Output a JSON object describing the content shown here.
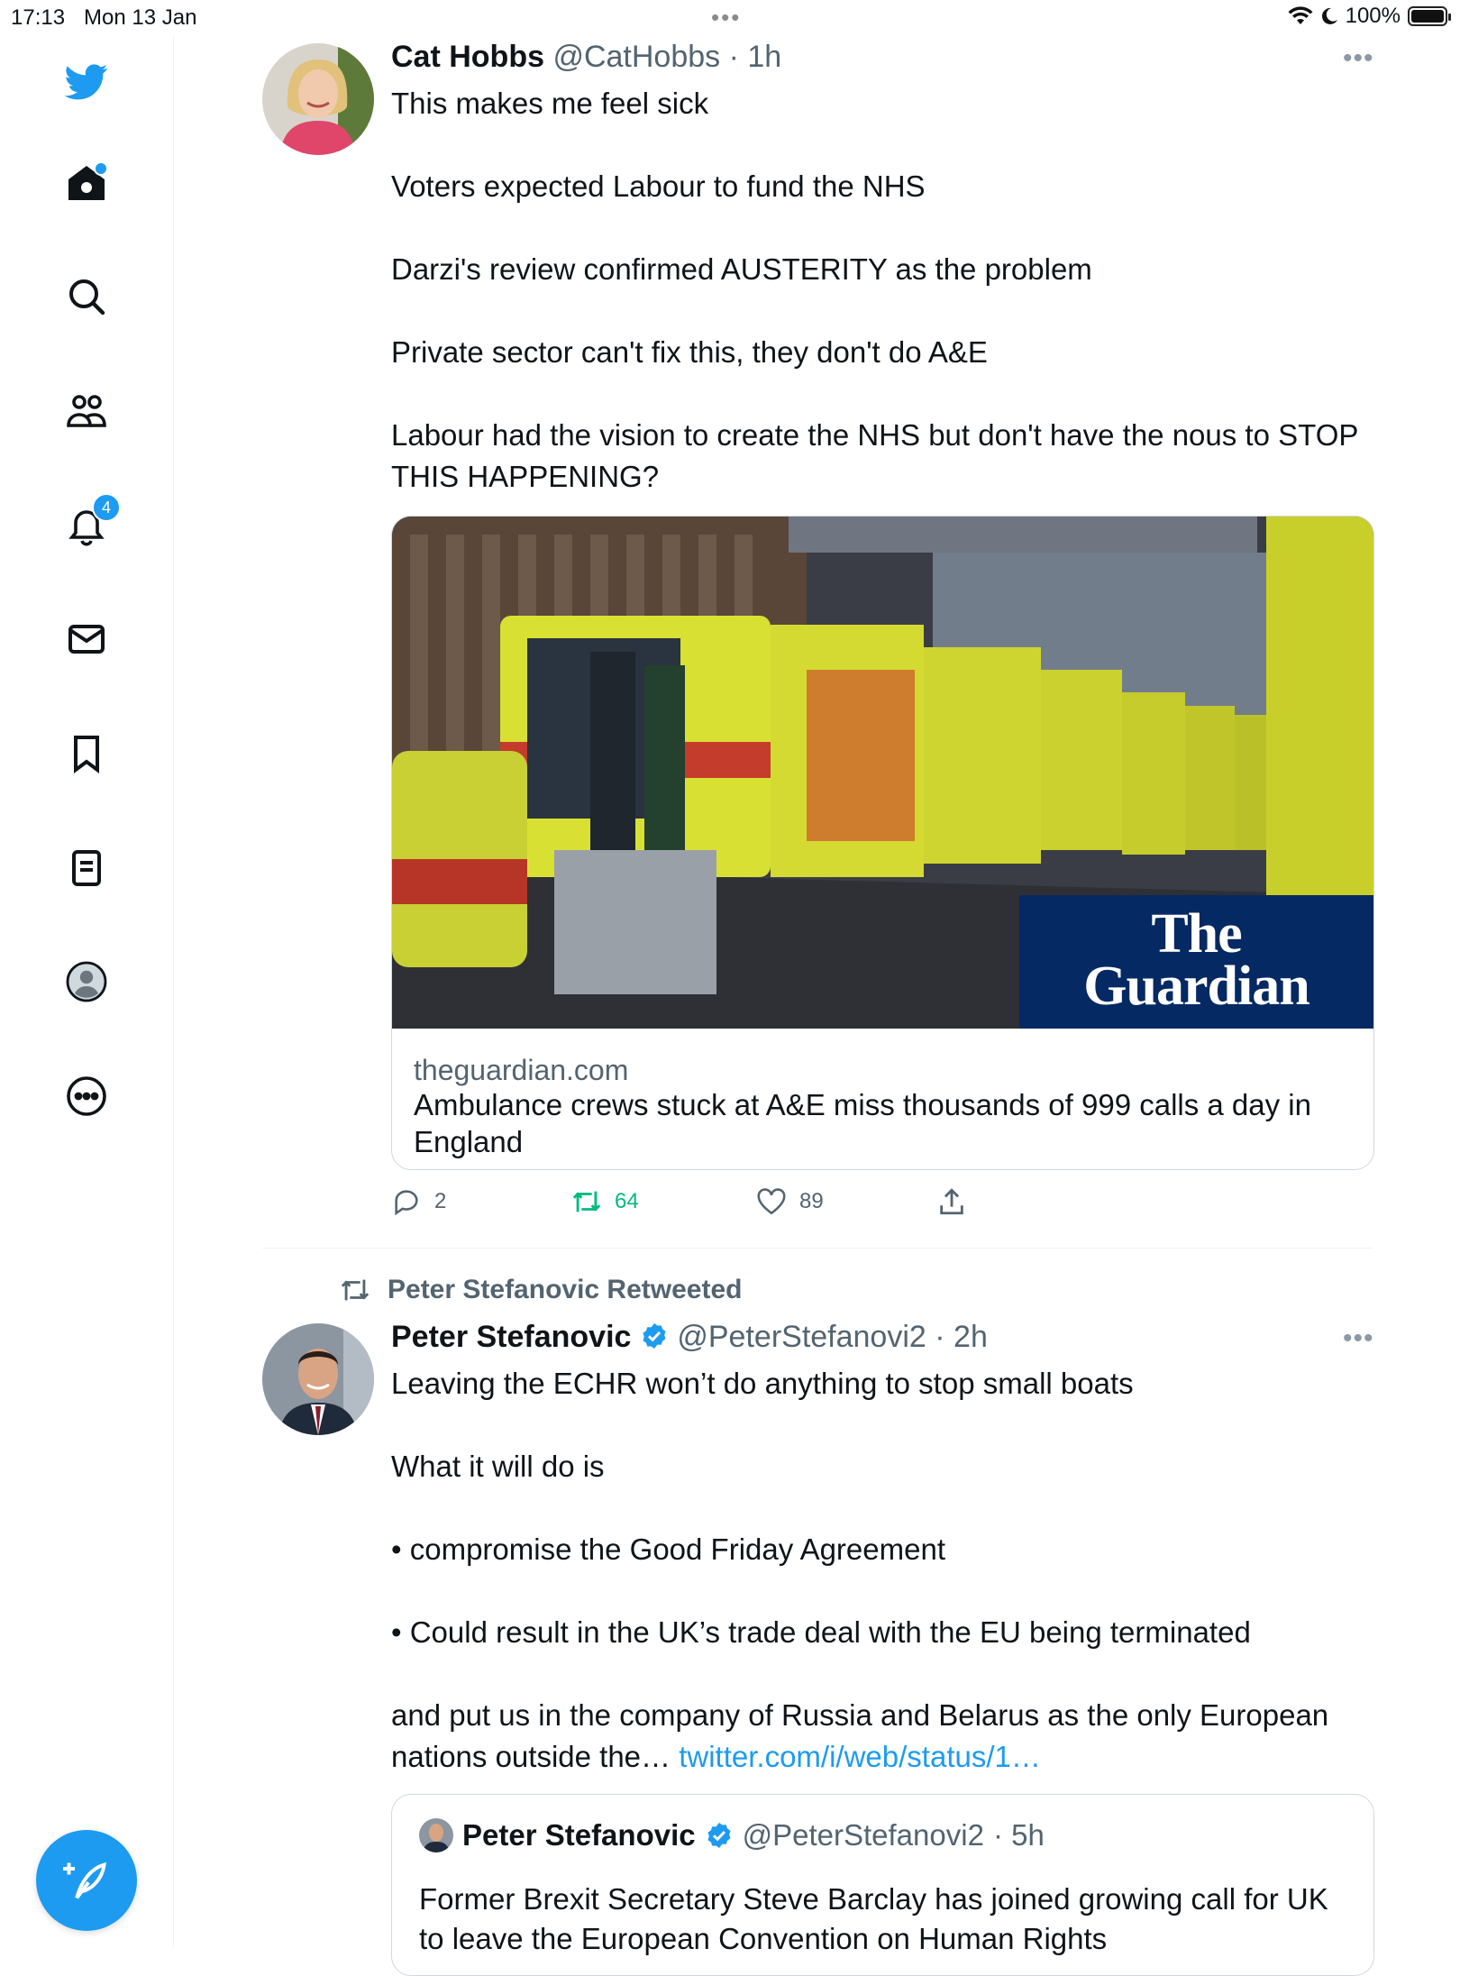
{
  "status_bar": {
    "time": "17:13",
    "date": "Mon 13 Jan",
    "multitask_dots": "•••",
    "battery": "100%"
  },
  "sidebar": {
    "icons": [
      "twitter-logo-icon",
      "home-icon",
      "search-icon",
      "communities-icon",
      "notifications-icon",
      "messages-icon",
      "bookmarks-icon",
      "lists-icon",
      "profile-icon",
      "more-icon"
    ],
    "notifications_badge": "4"
  },
  "colors": {
    "accent": "#1d9bf0",
    "text": "#0f1419",
    "muted": "#536471",
    "retweet": "#00ba7c"
  },
  "tweets": [
    {
      "name": "Cat Hobbs",
      "handle": "@CatHobbs",
      "time": "· 1h",
      "more": "•••",
      "text": "This makes me feel sick\n\nVoters expected Labour to fund the NHS\n\nDarzi's review confirmed AUSTERITY as the problem\n\nPrivate sector can't fix this, they don't do A&E\n\nLabour had the vision to create the NHS but don't have the nous to STOP THIS HAPPENING?",
      "card": {
        "image_logo_line1": "The",
        "image_logo_line2": "Guardian",
        "domain": "theguardian.com",
        "title": "Ambulance crews stuck at A&E miss thousands of 999 calls a day in England"
      },
      "replies": "2",
      "retweets": "64",
      "likes": "89"
    },
    {
      "retweeted_by": "Peter Stefanovic Retweeted",
      "name": "Peter Stefanovic",
      "handle": "@PeterStefanovi2",
      "time": "· 2h",
      "more": "•••",
      "text": "Leaving the ECHR won’t do anything to stop small boats\n\nWhat it will do is\n\n• compromise the Good Friday Agreement\n\n• Could result in the UK’s trade deal with the EU being terminated\n\nand put us in the company of Russia and Belarus as the only European nations outside the…",
      "link": "twitter.com/i/web/status/1…",
      "quote": {
        "name": "Peter Stefanovic",
        "handle": "@PeterStefanovi2",
        "time": "· 5h",
        "text": "Former Brexit Secretary Steve Barclay has joined growing call for UK to leave the European Convention on Human Rights"
      }
    }
  ]
}
